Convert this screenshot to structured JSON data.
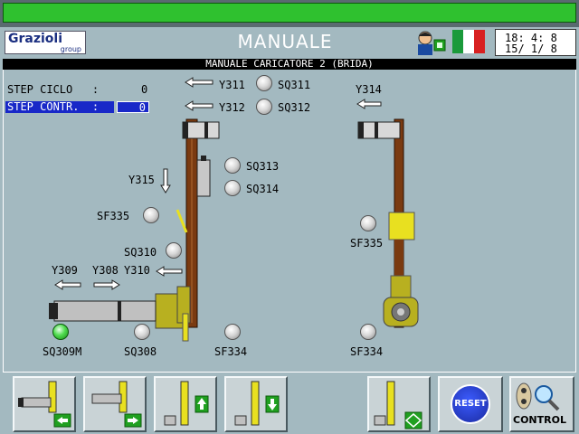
{
  "header": {
    "logo": "Grazioli",
    "logo_sub": "group",
    "title": "MANUALE",
    "clock_time": "18: 4: 8",
    "clock_date": "15/ 1/ 8"
  },
  "subtitle": "MANUALE CARICATORE 2 (BRIDA)",
  "steps": {
    "ciclo_label": "STEP CICLO   :",
    "ciclo_value": "0",
    "contr_label": "STEP CONTR.  :",
    "contr_value": "0"
  },
  "labels": {
    "y311": "Y311",
    "sq311": "SQ311",
    "y312": "Y312",
    "sq312": "SQ312",
    "y314": "Y314",
    "sq313": "SQ313",
    "sq314": "SQ314",
    "y315": "Y315",
    "sf335_left": "SF335",
    "sf335_right": "SF335",
    "sq310": "SQ310",
    "y309": "Y309",
    "y308": "Y308",
    "y310": "Y310",
    "sq309m": "SQ309M",
    "sq308": "SQ308",
    "sf334_left": "SF334",
    "sf334_right": "SF334"
  },
  "buttons": {
    "reset": "RESET",
    "control": "CONTROL"
  },
  "colors": {
    "background": "#a3b9c0",
    "status_bar": "#2fc12f",
    "selection": "#1828c8",
    "column": "#7a3a10",
    "actuator": "#b8b020",
    "lamp_on": "#4fdc4f"
  },
  "icons": {
    "operator": "operator-icon",
    "flag": "italy-flag-icon"
  }
}
